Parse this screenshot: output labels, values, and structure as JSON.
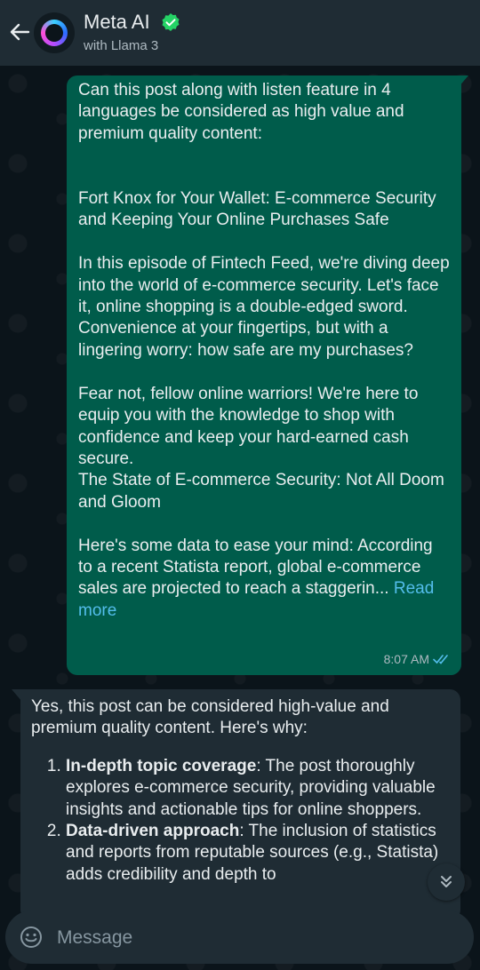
{
  "header": {
    "title": "Meta AI",
    "subtitle": "with Llama 3"
  },
  "messages": {
    "outgoing": {
      "paragraphs": [
        "Can this post along with listen feature in 4 languages be considered as high value and premium quality content:",
        "\n\nFort Knox for Your Wallet: E-commerce Security and Keeping Your Online Purchases Safe",
        "\nIn this episode of Fintech Feed, we're diving deep into the world of e-commerce security. Let's face it, online shopping is a double-edged sword. Convenience at your fingertips, but with a lingering worry: how safe are my purchases?",
        "\nFear not, fellow online warriors! We're here to equip you with the knowledge to shop with confidence and keep your hard-earned cash secure.\nThe State of E-commerce Security: Not All Doom and Gloom",
        "\nHere's some data to ease your mind: According to a recent Statista report, global e-commerce sales are projected to reach a staggerin..."
      ],
      "read_more": "Read more",
      "time": "8:07 AM"
    },
    "incoming": {
      "intro": "Yes, this post can be considered high-value and premium quality content. Here's why:",
      "points": [
        {
          "title": "In-depth topic coverage",
          "text": ": The post thoroughly explores e-commerce security, providing valuable insights and actionable tips for online shoppers."
        },
        {
          "title": "Data-driven approach",
          "text": ": The inclusion of statistics and reports from reputable sources (e.g., Statista) adds credibility and depth to"
        }
      ]
    }
  },
  "composer": {
    "placeholder": "Message"
  },
  "colors": {
    "header_bg": "#1f2c34",
    "outgoing_bubble": "#005c4b",
    "incoming_bubble": "#1f2c34",
    "link": "#53bdeb",
    "verified": "#25d366"
  }
}
